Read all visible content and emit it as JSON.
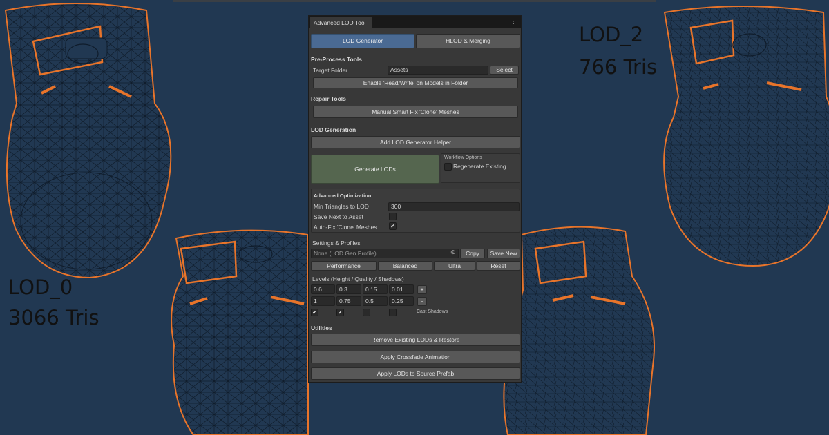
{
  "viewport_labels": {
    "lod0_name": "LOD_0",
    "lod0_tris": "3066 Tris",
    "lod2_name": "LOD_2",
    "lod2_tris": "766 Tris"
  },
  "window": {
    "tab_title": "Advanced LOD Tool",
    "menu_icon": "kebab-menu-icon"
  },
  "tabs": [
    {
      "label": "LOD Generator",
      "active": true
    },
    {
      "label": "HLOD & Merging",
      "active": false
    }
  ],
  "preprocess": {
    "header": "Pre-Process Tools",
    "target_label": "Target Folder",
    "target_value": "Assets",
    "select_label": "Select",
    "enable_rw_label": "Enable 'Read/Write' on Models in Folder"
  },
  "repair": {
    "header": "Repair Tools",
    "fix_label": "Manual Smart Fix 'Clone' Meshes"
  },
  "lod_generation": {
    "header": "LOD Generation",
    "add_helper_label": "Add LOD Generator Helper",
    "generate_label": "Generate LODs",
    "workflow_title": "Workflow Options",
    "regenerate_label": "Regenerate Existing",
    "regenerate_checked": false
  },
  "advanced": {
    "header": "Advanced Optimization",
    "min_tris_label": "Min Triangles to LOD",
    "min_tris_value": "300",
    "save_next_label": "Save Next to Asset",
    "save_next_checked": false,
    "autofix_label": "Auto-Fix 'Clone' Meshes",
    "autofix_checked": true
  },
  "profiles": {
    "header": "Settings & Profiles",
    "profile_value": "None (LOD Gen Profile)",
    "picker_icon": "object-picker-icon",
    "copy_label": "Copy",
    "save_new_label": "Save New",
    "presets": [
      "Performance",
      "Balanced",
      "Ultra",
      "Reset"
    ]
  },
  "levels": {
    "header": "Levels (Height / Quality / Shadows)",
    "height": [
      "0.6",
      "0.3",
      "0.15",
      "0.01"
    ],
    "quality": [
      "1",
      "0.75",
      "0.5",
      "0.25"
    ],
    "shadows": [
      true,
      true,
      false,
      false
    ],
    "add_label": "+",
    "remove_label": "-",
    "cast_shadows_label": "Cast Shadows"
  },
  "utilities": {
    "header": "Utilities",
    "remove_label": "Remove Existing LODs & Restore",
    "crossfade_label": "Apply Crossfade Animation",
    "apply_source_label": "Apply LODs to Source Prefab"
  },
  "colors": {
    "background": "#213852",
    "wire": "#0f1c2b",
    "outline": "#e8742a",
    "panel": "#383838",
    "tab_active": "#4a6a93",
    "generate_button": "#55664f"
  }
}
